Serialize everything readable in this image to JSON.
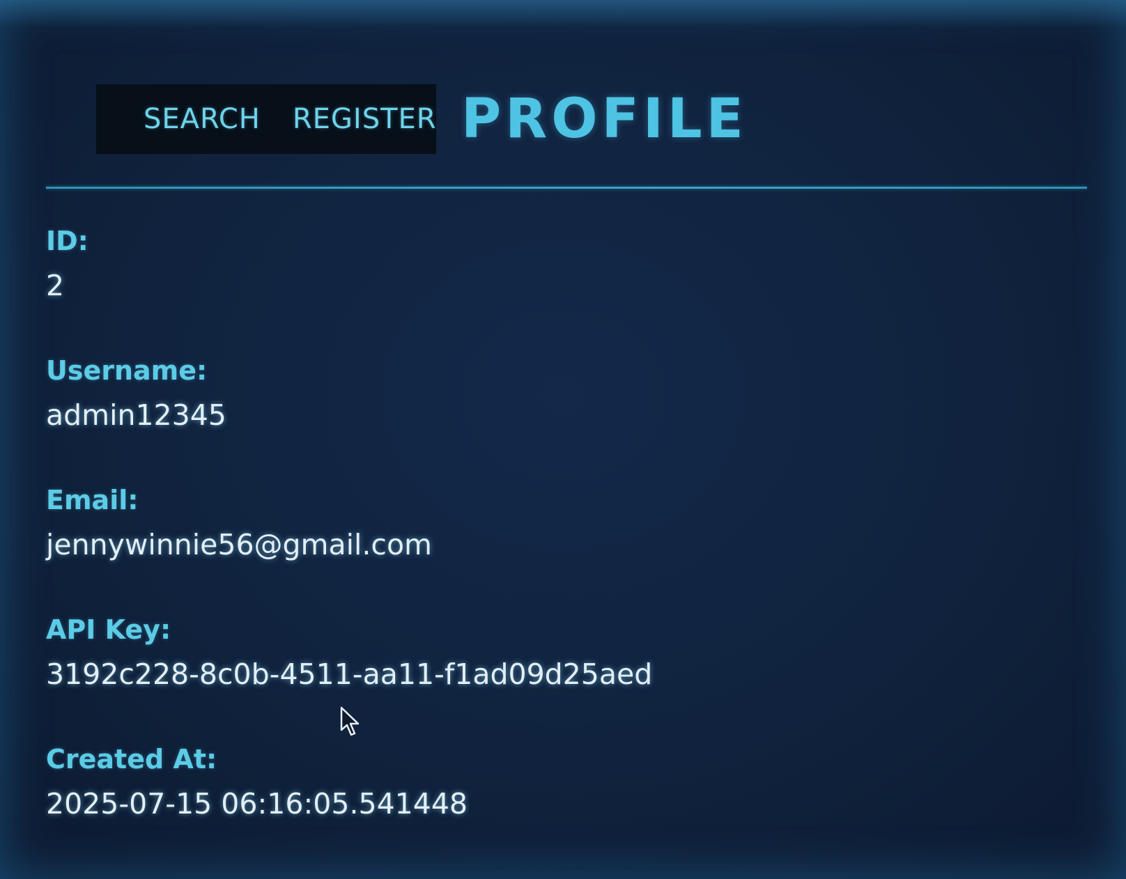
{
  "nav": {
    "links": [
      "SEARCH",
      "REGISTER"
    ]
  },
  "page": {
    "title": "PROFILE"
  },
  "profile": {
    "fields": [
      {
        "label": "ID:",
        "value": "2"
      },
      {
        "label": "Username:",
        "value": "admin12345"
      },
      {
        "label": "Email:",
        "value": "jennywinnie56@gmail.com"
      },
      {
        "label": "API Key:",
        "value": "3192c228-8c0b-4511-aa11-f1ad09d25aed"
      },
      {
        "label": "Created At:",
        "value": "2025-07-15 06:16:05.541448"
      }
    ]
  },
  "colors": {
    "background": "#10223d",
    "accent": "#4fc3e4",
    "label": "#5ccbe6",
    "value": "#e4eef5",
    "nav_bg": "#060e16"
  },
  "icons": {
    "cursor": "mouse-pointer-icon"
  }
}
